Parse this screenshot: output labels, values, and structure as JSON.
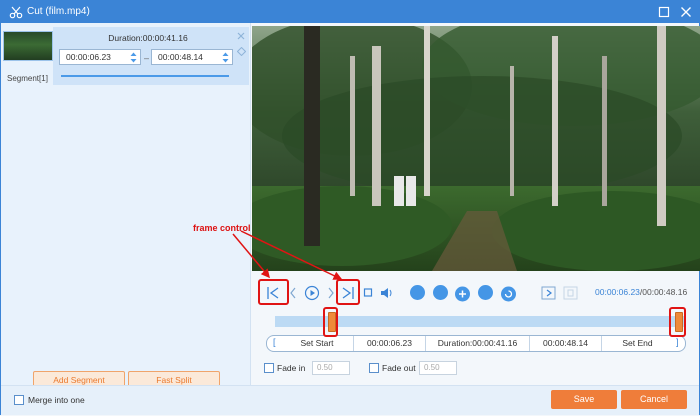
{
  "window": {
    "title": "Cut (film.mp4)"
  },
  "segments": [
    {
      "label": "Segment[1]",
      "duration": "Duration:00:00:41.16",
      "start": "00:00:06.23",
      "end": "00:00:48.14"
    }
  ],
  "left_actions": {
    "add_segment": "Add Segment",
    "fast_split": "Fast Split"
  },
  "annotation": {
    "text": "frame control"
  },
  "player": {
    "current_time": "00:00:06.23",
    "total_time": "/00:00:48.16"
  },
  "info_bar": {
    "set_start": "Set Start",
    "start": "00:00:06.23",
    "duration": "Duration:00:00:41.16",
    "end": "00:00:48.14",
    "set_end": "Set End"
  },
  "fade": {
    "in_label": "Fade in",
    "in_value": "0.50",
    "in_checked": false,
    "out_label": "Fade out",
    "out_value": "0.50",
    "out_checked": false
  },
  "footer": {
    "merge_label": "Merge into one",
    "merge_checked": false,
    "save_label": "Save",
    "cancel_label": "Cancel"
  },
  "colors": {
    "accent": "#3b84d6",
    "orange": "#ef7d3a",
    "annotation_red": "#e01414"
  }
}
